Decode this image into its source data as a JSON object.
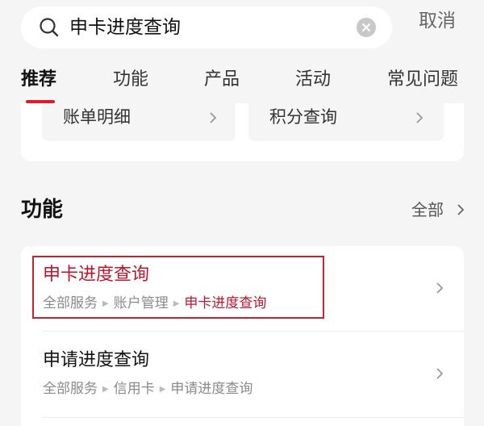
{
  "search": {
    "query": "申卡进度查询",
    "cancel_label": "取消"
  },
  "tabs": [
    "推荐",
    "功能",
    "产品",
    "活动",
    "常见问题"
  ],
  "quick_items": [
    "账单明细",
    "积分查询"
  ],
  "section": {
    "title": "功能",
    "more_label": "全部"
  },
  "results": [
    {
      "title": "申卡进度查询",
      "breadcrumb": [
        "全部服务",
        "账户管理",
        "申卡进度查询"
      ]
    },
    {
      "title": "申请进度查询",
      "breadcrumb": [
        "全部服务",
        "信用卡",
        "申请进度查询"
      ]
    }
  ],
  "colors": {
    "accent": "#e0192f",
    "highlight_text": "#c0162b",
    "highlight_box": "#c8222e"
  }
}
